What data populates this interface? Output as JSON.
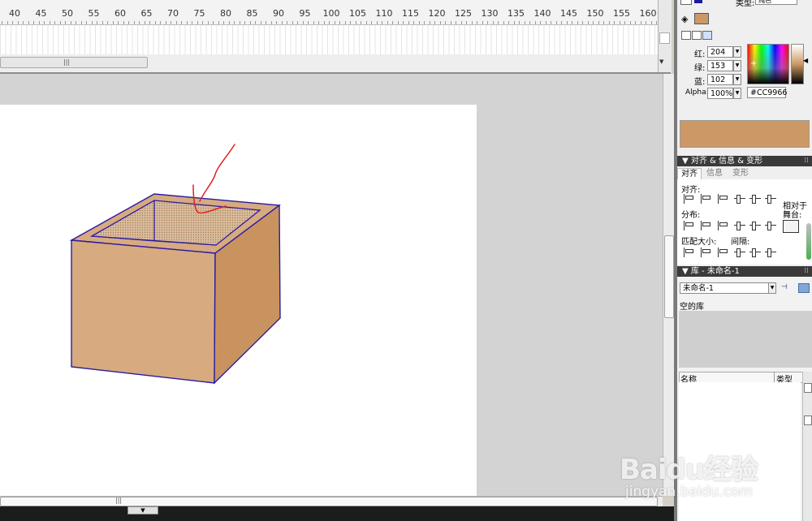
{
  "ruler": {
    "labels": [
      "40",
      "45",
      "50",
      "55",
      "60",
      "65",
      "70",
      "75",
      "80",
      "85",
      "90",
      "95",
      "100",
      "105",
      "110",
      "115",
      "120",
      "125",
      "130",
      "135",
      "140",
      "145",
      "150",
      "155",
      "160"
    ]
  },
  "timeline": {
    "scroll_grip": "|||"
  },
  "stage": {
    "scroll_grip": "|||",
    "property_tab": "▼"
  },
  "color_panel": {
    "fill_type_label": "类型:",
    "fill_type_value": "纯色",
    "red_label": "红:",
    "red_value": "204",
    "green_label": "绿:",
    "green_value": "153",
    "blue_label": "蓝:",
    "blue_value": "102",
    "alpha_label": "Alpha:",
    "alpha_value": "100%",
    "hex_value": "#CC9966",
    "fill_color": "#cc9966",
    "stroke_color": "#1a1aa0"
  },
  "align_panel": {
    "title": "▼ 对齐 & 信息 & 变形",
    "tabs": [
      "对齐",
      "信息",
      "变形"
    ],
    "align_label": "对齐:",
    "distribute_label": "分布:",
    "match_size_label": "匹配大小:",
    "spacing_label": "间隔:",
    "to_stage_label_1": "相对于",
    "to_stage_label_2": "舞台:"
  },
  "library_panel": {
    "title": "▼ 库 - 未命名-1",
    "selected_document": "未命名-1",
    "empty_text": "空的库",
    "col_name": "名称",
    "col_type": "类型"
  },
  "watermark": {
    "brand": "Baidu经验",
    "url": "jingyan.baidu.com"
  },
  "colors": {
    "panel_header": "#3a3a3a",
    "box_front": "#d7aa80",
    "box_side": "#c8935f",
    "box_stroke": "#2a1ca0",
    "annotation": "#e02020"
  }
}
